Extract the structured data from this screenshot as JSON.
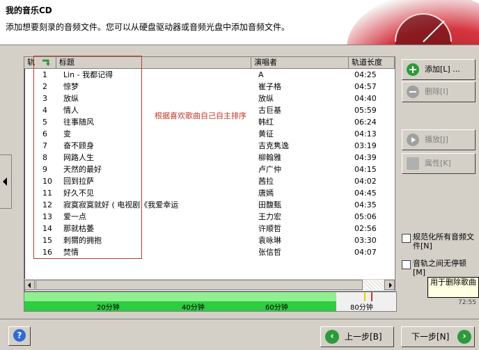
{
  "header": {
    "title": "我的音乐CD",
    "subtitle": "添加想要刻录的音频文件。您可以从硬盘驱动器或音频光盘中添加音频文件。"
  },
  "table": {
    "columns": [
      "轨",
      "标题",
      "演唱者",
      "轨道长度"
    ],
    "rows": [
      {
        "num": "1",
        "title": "Lin - 我都记得",
        "artist": "A",
        "length": "04:25"
      },
      {
        "num": "2",
        "title": "惊梦",
        "artist": "崔子格",
        "length": "04:57"
      },
      {
        "num": "3",
        "title": "放纵",
        "artist": "放纵",
        "length": "04:40"
      },
      {
        "num": "4",
        "title": "情人",
        "artist": "古巨基",
        "length": "05:59"
      },
      {
        "num": "5",
        "title": "往事随风",
        "artist": "韩红",
        "length": "06:24"
      },
      {
        "num": "6",
        "title": "变",
        "artist": "黄征",
        "length": "04:13"
      },
      {
        "num": "7",
        "title": "奋不顾身",
        "artist": "吉克隽逸",
        "length": "03:19"
      },
      {
        "num": "8",
        "title": "网路人生",
        "artist": "柳翰雅",
        "length": "04:39"
      },
      {
        "num": "9",
        "title": "天然的最好",
        "artist": "卢广仲",
        "length": "04:15"
      },
      {
        "num": "10",
        "title": "回到拉萨",
        "artist": "茜拉",
        "length": "04:02"
      },
      {
        "num": "11",
        "title": "好久不见",
        "artist": "唐嫣",
        "length": "04:45"
      },
      {
        "num": "12",
        "title": "寂寞寂寞就好 ( 电视剧《我爱幸运",
        "artist": "田馥甄",
        "length": "04:35"
      },
      {
        "num": "13",
        "title": "爱一点",
        "artist": "王力宏",
        "length": "05:06"
      },
      {
        "num": "14",
        "title": "那就枯萎",
        "artist": "许顺哲",
        "length": "02:56"
      },
      {
        "num": "15",
        "title": "刺猬的拥抱",
        "artist": "袁咏琳",
        "length": "03:30"
      },
      {
        "num": "16",
        "title": "焚情",
        "artist": "张信哲",
        "length": "04:07"
      }
    ]
  },
  "annotation": "根据喜欢歌曲自己自主排序",
  "buttons": {
    "add": "添加[L] ...",
    "remove": "删除[I]",
    "play": "播放[J]",
    "properties": "属性[K]"
  },
  "checkboxes": {
    "normalize": "规范化所有音频文件[N]",
    "no_gap": "音轨之间无停顿[M]"
  },
  "tooltip": "用于删除歌曲 光盘上的更多",
  "capacity": {
    "labels": [
      "20分钟",
      "40分钟",
      "60分钟",
      "80分钟"
    ],
    "time_text": "72:55",
    "used_fraction": 0.84
  },
  "footer": {
    "help": "?",
    "back": "上一步[B]",
    "next": "下一步[N]"
  },
  "colors": {
    "accent_red": "#c0392b",
    "capacity_green": "#2ecc40",
    "nav_green": "#2c9a3a"
  }
}
